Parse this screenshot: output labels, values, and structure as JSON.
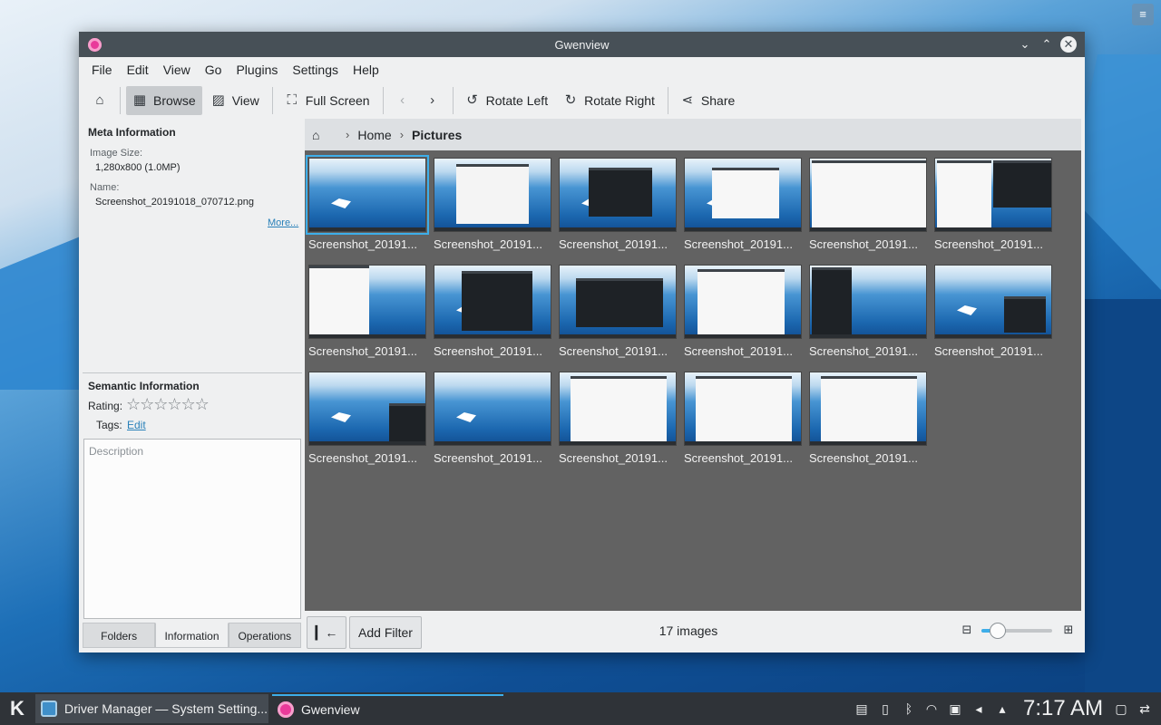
{
  "window": {
    "title": "Gwenview"
  },
  "menu": [
    "File",
    "Edit",
    "View",
    "Go",
    "Plugins",
    "Settings",
    "Help"
  ],
  "toolbar": {
    "home_icon": "home-icon",
    "browse": "Browse",
    "view": "View",
    "fullscreen": "Full Screen",
    "rotate_left": "Rotate Left",
    "rotate_right": "Rotate Right",
    "share": "Share"
  },
  "sidebar": {
    "meta_title": "Meta Information",
    "image_size_label": "Image Size:",
    "image_size_value": "1,280x800 (1.0MP)",
    "name_label": "Name:",
    "name_value": "Screenshot_20191018_070712.png",
    "more": "More...",
    "semantic_title": "Semantic Information",
    "rating_label": "Rating:",
    "rating_stars": "☆☆☆☆☆☆",
    "tags_label": "Tags:",
    "tags_edit": "Edit",
    "description_placeholder": "Description",
    "tabs": [
      "Folders",
      "Information",
      "Operations"
    ],
    "active_tab": "Information"
  },
  "breadcrumb": [
    "Home",
    "Pictures"
  ],
  "thumbnails": [
    "Screenshot_20191...",
    "Screenshot_20191...",
    "Screenshot_20191...",
    "Screenshot_20191...",
    "Screenshot_20191...",
    "Screenshot_20191...",
    "Screenshot_20191...",
    "Screenshot_20191...",
    "Screenshot_20191...",
    "Screenshot_20191...",
    "Screenshot_20191...",
    "Screenshot_20191...",
    "Screenshot_20191...",
    "Screenshot_20191...",
    "Screenshot_20191...",
    "Screenshot_20191...",
    "Screenshot_20191..."
  ],
  "selected_index": 0,
  "statusbar": {
    "back_button": "▎←",
    "add_filter": "Add Filter",
    "count": "17 images",
    "zoom_level": 0.23
  },
  "taskbar": {
    "tasks": [
      "Driver Manager — System Setting...",
      "Gwenview"
    ],
    "clock": "7:17 AM"
  },
  "colors": {
    "accent": "#3daee9",
    "titlebar": "#475057",
    "grid_bg": "#626262"
  }
}
